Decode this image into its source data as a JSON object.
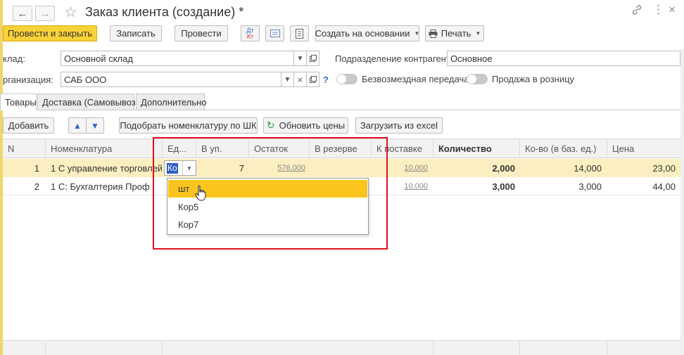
{
  "window": {
    "title": "Заказ клиента (создание) *"
  },
  "toolbar": {
    "post_close": "Провести и закрыть",
    "save": "Записать",
    "post": "Провести",
    "dtkt": "Дт Кт",
    "create_based": "Создать на основании",
    "print": "Печать"
  },
  "form": {
    "warehouse_label": "клад:",
    "warehouse_value": "Основной склад",
    "org_label": "рганизация:",
    "org_value": "САБ ООО",
    "counterparty_div_label": "Подразделение контрагента:",
    "counterparty_div_value": "Основное",
    "free_transfer_label": "Безвозмездная передача",
    "retail_label": "Продажа в розницу",
    "help": "?"
  },
  "tabs": [
    "Товары",
    "Доставка (Самовывоз)",
    "Дополнительно"
  ],
  "table_toolbar": {
    "add": "Добавить",
    "pick_by_barcode": "Подобрать номенклатуру по ШК",
    "refresh_prices": "Обновить цены",
    "load_excel": "Загрузить из excel"
  },
  "table": {
    "columns": [
      "N",
      "Номенклатура",
      "Ед...",
      "В уп.",
      "Остаток",
      "В резерве",
      "К поставке",
      "Количество",
      "Ко-во (в баз. ед.)",
      "Цена"
    ],
    "rows": [
      {
        "n": "1",
        "item": "1 С управление торговлей",
        "unit": "Ко",
        "per_pack": "7",
        "stock": "576,000",
        "reserve": "",
        "to_deliver": "10,000",
        "qty": "2,000",
        "qty_base": "14,000",
        "price": "23,00"
      },
      {
        "n": "2",
        "item": "1 С:  Бухгалтерия Проф",
        "unit": "",
        "per_pack": "",
        "stock": "",
        "reserve": "",
        "to_deliver": "10,000",
        "qty": "3,000",
        "qty_base": "3,000",
        "price": "44,00"
      }
    ]
  },
  "unit_dropdown": {
    "options": [
      "шт",
      "Кор5",
      "Кор7"
    ],
    "highlighted": "шт"
  },
  "colors": {
    "primary_button": "#f9d238",
    "selected_row": "#fbeec0",
    "dropdown_highlight": "#fbc41d",
    "annotation_frame": "#e0101b",
    "selection": "#2f5fc4"
  },
  "icons": [
    "back-arrow-icon",
    "forward-arrow-icon",
    "star-icon",
    "link-icon",
    "more-icon",
    "close-icon",
    "dtkt-icon",
    "document-icon",
    "list-icon",
    "print-icon",
    "refresh-icon",
    "arrow-up-icon",
    "arrow-down-icon",
    "open-icon",
    "clear-icon",
    "cursor-icon"
  ]
}
